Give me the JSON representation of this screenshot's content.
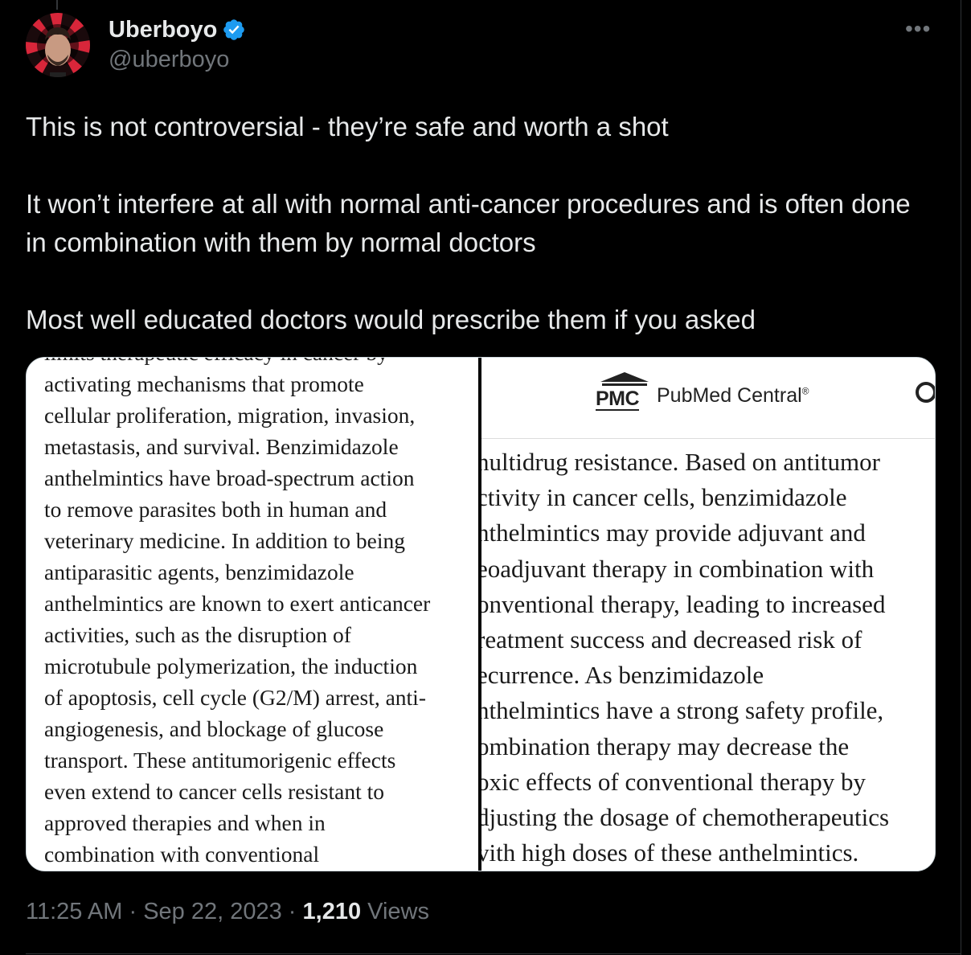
{
  "author": {
    "name": "Uberboyo",
    "handle": "@uberboyo",
    "verified": true
  },
  "tweet": {
    "paragraphs": [
      "This is not controversial - they’re safe and worth a shot",
      "It won’t interfere at all with normal anti-cancer procedures and is often done in combination with them by normal doctors",
      "Most well educated doctors would prescribe them if you asked"
    ]
  },
  "media": {
    "left_lines": [
      "limits therapeutic efficacy in cancer by",
      "activating mechanisms that promote",
      "cellular proliferation, migration, invasion,",
      "metastasis, and survival. Benzimidazole",
      "anthelmintics have broad-spectrum action",
      "to remove parasites both in human and",
      "veterinary medicine. In addition to being",
      "antiparasitic agents, benzimidazole",
      "anthelmintics are known to exert anticancer",
      "activities, such as the disruption of",
      "microtubule polymerization, the induction",
      "of apoptosis, cell cycle (G2/M) arrest, anti-",
      "angiogenesis, and blockage of glucose",
      "transport. These antitumorigenic effects",
      "even extend to cancer cells resistant to",
      "approved therapies and when in",
      "combination with conventional"
    ],
    "pmc_logo_text": "PMC",
    "pmc_title": "PubMed Central",
    "pmc_reg": "®",
    "right_lines": [
      "nultidrug resistance. Based on antitumor",
      "ctivity in cancer cells, benzimidazole",
      "nthelmintics may provide adjuvant and",
      "eoadjuvant therapy in combination with",
      "onventional therapy, leading to increased",
      "reatment success and decreased risk of",
      "ecurrence. As benzimidazole",
      "nthelmintics have a strong safety profile,",
      "ombination therapy may decrease the",
      "oxic effects of conventional therapy by",
      "djusting the dosage of chemotherapeutics",
      "vith high doses of these anthelmintics."
    ]
  },
  "meta": {
    "time": "11:25 AM",
    "date": "Sep 22, 2023",
    "views_count": "1,210",
    "views_label": "Views",
    "separator": "·"
  },
  "colors": {
    "background": "#000000",
    "text_primary": "#e7e9ea",
    "text_secondary": "#71767b",
    "verified_blue": "#1d9bf0"
  },
  "icons": [
    "verified-badge-icon",
    "more-options-icon",
    "search-icon",
    "pmc-building-logo"
  ]
}
